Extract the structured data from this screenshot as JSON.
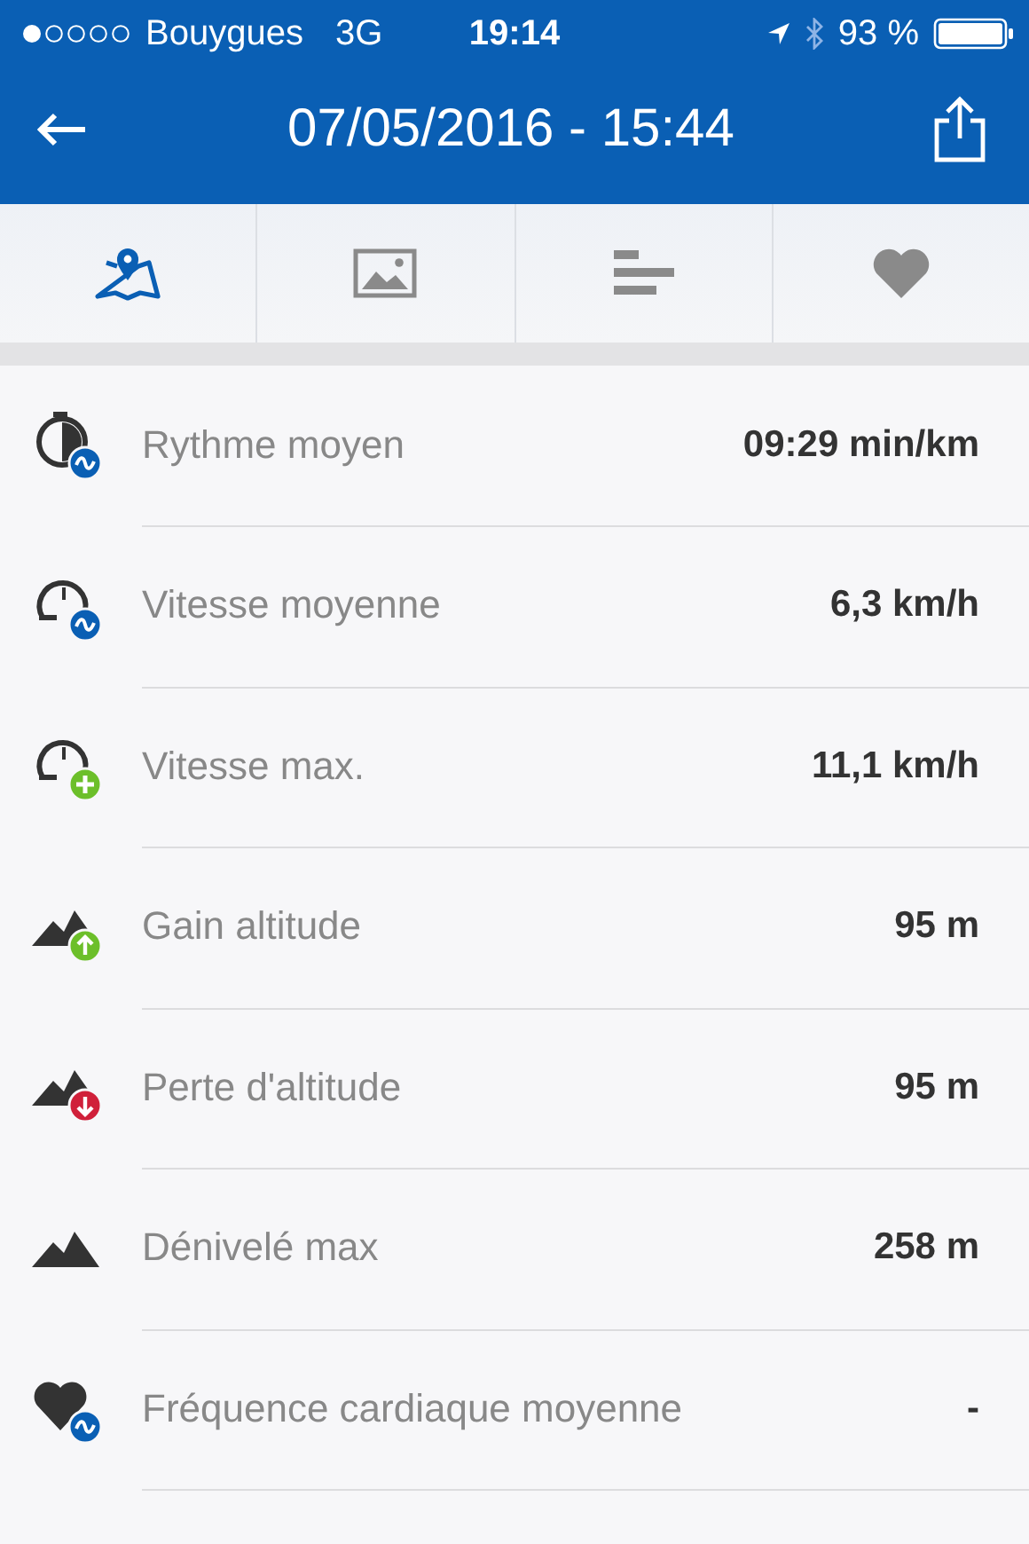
{
  "status_bar": {
    "carrier": "Bouygues",
    "network": "3G",
    "time": "19:14",
    "battery": "93 %"
  },
  "header": {
    "title": "07/05/2016 - 15:44"
  },
  "tabs": [
    {
      "kind": "map",
      "selected": true
    },
    {
      "kind": "photo",
      "selected": false
    },
    {
      "kind": "bars",
      "selected": false
    },
    {
      "kind": "heart",
      "selected": false
    }
  ],
  "stats": [
    {
      "kind": "pace",
      "label": "Rythme moyen",
      "value": "09:29 min/km"
    },
    {
      "kind": "avgspeed",
      "label": "Vitesse moyenne",
      "value": "6,3 km/h"
    },
    {
      "kind": "maxspeed",
      "label": "Vitesse max.",
      "value": "11,1 km/h"
    },
    {
      "kind": "ascent",
      "label": "Gain altitude",
      "value": "95 m"
    },
    {
      "kind": "descent",
      "label": "Perte d'altitude",
      "value": "95 m"
    },
    {
      "kind": "elevation",
      "label": "Dénivelé max",
      "value": "258 m"
    },
    {
      "kind": "heartrate",
      "label": "Fréquence cardiaque moyenne",
      "value": "-"
    }
  ]
}
